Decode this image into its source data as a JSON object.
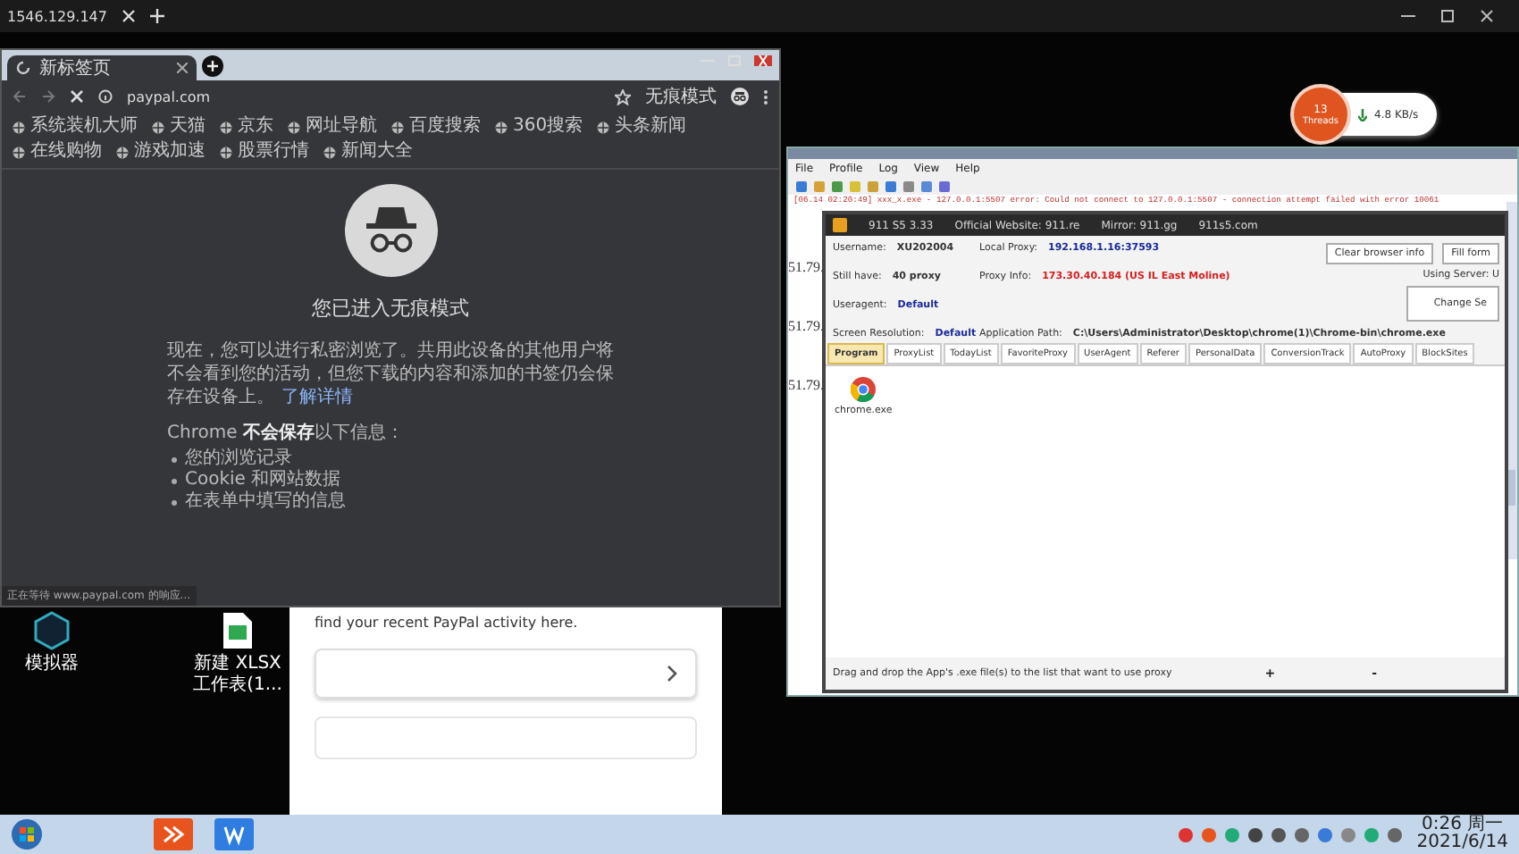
{
  "remote_bar": {
    "address": "1546.129.147"
  },
  "browser": {
    "tab_title": "新标签页",
    "url": "paypal.com",
    "incognito_label": "无痕模式",
    "bookmarks": [
      "系统装机大师",
      "天猫",
      "京东",
      "网址导航",
      "百度搜索",
      "360搜索",
      "头条新闻",
      "在线购物",
      "游戏加速",
      "股票行情",
      "新闻大全"
    ],
    "heading": "您已进入无痕模式",
    "intro": "现在，您可以进行私密浏览了。共用此设备的其他用户将不会看到您的活动，但您下载的内容和添加的书签仍会保存在设备上。",
    "learn_more": "了解详情",
    "not_saved_title": "Chrome **不会保存**以下信息：",
    "not_saved_items": [
      "您的浏览记录",
      "Cookie 和网站数据",
      "在表单中填写的信息"
    ],
    "status": "正在等待 www.paypal.com 的响应..."
  },
  "desktop_icons": [
    {
      "label": "模拟器"
    },
    {
      "label": "新建 XLSX 工作表(1..."
    }
  ],
  "background_page": {
    "text": "find your recent PayPal activity here."
  },
  "proxy_app": {
    "menu": [
      "File",
      "Profile",
      "Log",
      "View",
      "Help"
    ],
    "log_lines": [
      "[06.14 02:20:49] xxx_x.exe - 127.0.0.1:5507 error: Could not connect to 127.0.0.1:5507 - connection attempt failed with error 10061"
    ],
    "side_lines": [
      "51.79.",
      "51.79.",
      "51.79."
    ],
    "title": "911 S5 3.33",
    "website": "Official Website: 911.re",
    "mirror": "Mirror: 911.gg",
    "alt_site": "911s5.com",
    "fields": [
      {
        "label": "Username:",
        "value": "XU202004",
        "color": "#333333"
      },
      {
        "label": "Local Proxy:",
        "value": "192.168.1.16:37593",
        "color": "#1a2a9a"
      },
      {
        "label": "Still have:",
        "value": "40 proxy",
        "color": "#333333"
      },
      {
        "label": "Proxy Info:",
        "value": "173.30.40.184 (US IL East Moline)",
        "color": "#d42020"
      },
      {
        "label": "Useragent:",
        "value": "Default",
        "color": "#1a2a9a"
      },
      {
        "label": "Screen Resolution:",
        "value": "Default",
        "color": "#1a2a9a"
      },
      {
        "label": "Application Path:",
        "value": "C:\\Users\\Administrator\\Desktop\\chrome(1)\\Chrome-bin\\chrome.exe",
        "color": "#333333"
      }
    ],
    "buttons": [
      "Clear browser info",
      "Fill form"
    ],
    "server_label": "Using Server: U",
    "change_button": "Change Se",
    "tabs": [
      {
        "label": "Program",
        "selected": true
      },
      {
        "label": "ProxyList",
        "selected": false
      },
      {
        "label": "TodayList",
        "selected": false
      },
      {
        "label": "FavoriteProxy",
        "selected": false
      },
      {
        "label": "UserAgent",
        "selected": false
      },
      {
        "label": "Referer",
        "selected": false
      },
      {
        "label": "PersonalData",
        "selected": false
      },
      {
        "label": "ConversionTrack",
        "selected": false
      },
      {
        "label": "AutoProxy",
        "selected": false
      },
      {
        "label": "BlockSites",
        "selected": false
      }
    ],
    "programs": [
      {
        "name": "chrome.exe"
      }
    ],
    "hint": "Drag and drop the App's .exe file(s) to the list that want to use proxy",
    "add": "+",
    "remove": "-"
  },
  "traffic": {
    "threads": "13",
    "threads_label": "Threads",
    "speed": "4.8 KB/s"
  },
  "taskbar": {
    "time": "0:26 周一",
    "date": "2021/6/14"
  }
}
